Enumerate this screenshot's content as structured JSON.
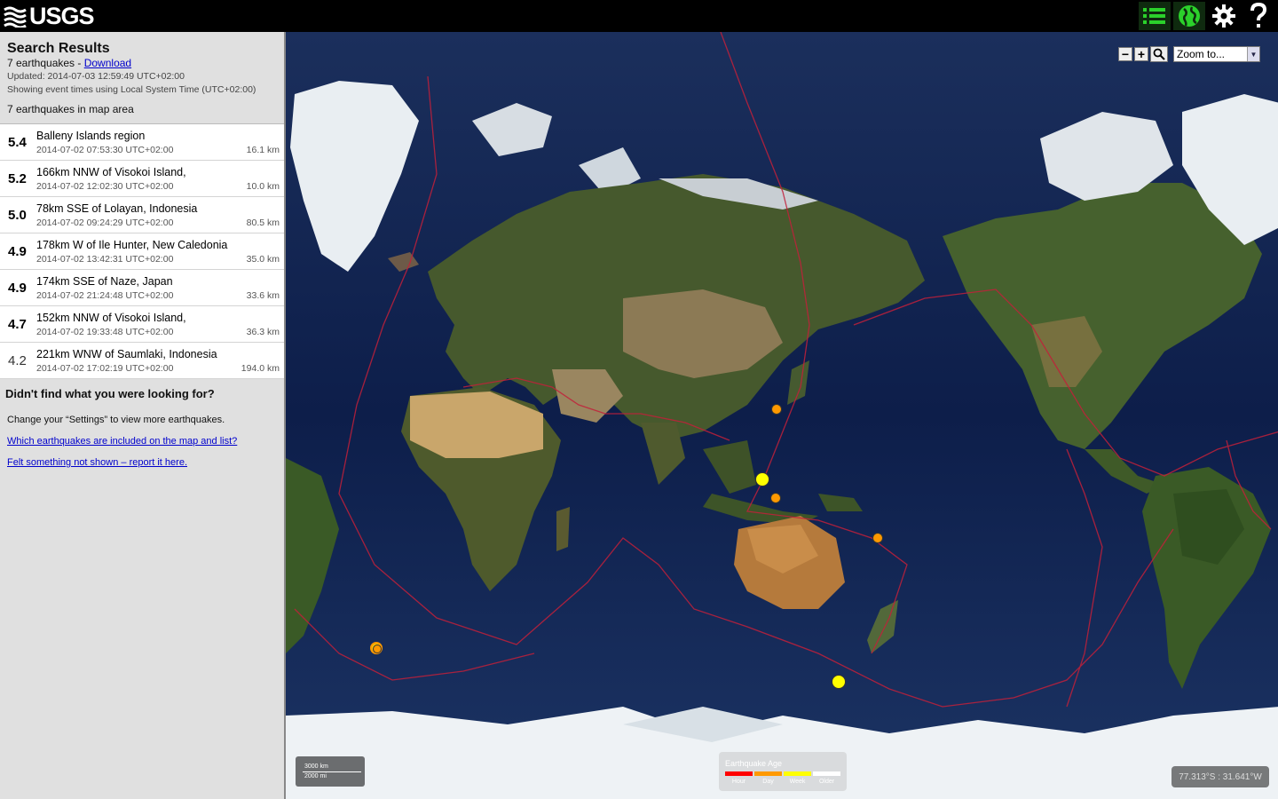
{
  "header": {
    "logo_text": "USGS",
    "buttons": [
      {
        "name": "list-icon"
      },
      {
        "name": "globe-icon"
      },
      {
        "name": "gear-icon"
      },
      {
        "name": "help-icon"
      }
    ]
  },
  "sidebar": {
    "title": "Search Results",
    "count_text": "7 earthquakes - ",
    "download_label": "Download",
    "updated": "Updated: 2014-07-03 12:59:49 UTC+02:00",
    "time_note": "Showing event times using Local System Time (UTC+02:00)",
    "in_area": "7 earthquakes in map area",
    "quakes": [
      {
        "mag": "5.4",
        "place": "Balleny Islands region",
        "time": "2014-07-02 07:53:30 UTC+02:00",
        "depth": "16.1 km",
        "color": "#ffff00"
      },
      {
        "mag": "5.2",
        "place": "166km NNW of Visokoi Island,",
        "time": "2014-07-02 12:02:30 UTC+02:00",
        "depth": "10.0 km",
        "color": "#ffff00"
      },
      {
        "mag": "5.0",
        "place": "78km SSE of Lolayan, Indonesia",
        "time": "2014-07-02 09:24:29 UTC+02:00",
        "depth": "80.5 km",
        "color": "#ffff00"
      },
      {
        "mag": "4.9",
        "place": "178km W of Ile Hunter, New Caledonia",
        "time": "2014-07-02 13:42:31 UTC+02:00",
        "depth": "35.0 km",
        "color": "#ff9900"
      },
      {
        "mag": "4.9",
        "place": "174km SSE of Naze, Japan",
        "time": "2014-07-02 21:24:48 UTC+02:00",
        "depth": "33.6 km",
        "color": "#ff9900"
      },
      {
        "mag": "4.7",
        "place": "152km NNW of Visokoi Island,",
        "time": "2014-07-02 19:33:48 UTC+02:00",
        "depth": "36.3 km",
        "color": "#ff9900"
      },
      {
        "mag": "4.2",
        "place": "221km WNW of Saumlaki, Indonesia",
        "time": "2014-07-02 17:02:19 UTC+02:00",
        "depth": "194.0 km",
        "color": "#ff9900"
      }
    ],
    "help_title": "Didn't find what you were looking for?",
    "help_text": "Change your “Settings” to view more earthquakes.",
    "help_link_1": "Which earthquakes are included on the map and list?",
    "help_link_2": "Felt something not shown – report it here."
  },
  "map": {
    "zoom_in_label": "+",
    "zoom_out_label": "−",
    "zoom_select_value": "Zoom to...",
    "scale_km": "3000 km",
    "scale_mi": "2000 mi",
    "legend_title": "Earthquake Age",
    "legend": [
      {
        "label": "Hour",
        "color": "#ff0000"
      },
      {
        "label": "Day",
        "color": "#ff9900"
      },
      {
        "label": "Week",
        "color": "#ffff00"
      },
      {
        "label": "Older",
        "color": "#ffffff"
      }
    ],
    "coords": "77.313°S : 31.641°W"
  }
}
